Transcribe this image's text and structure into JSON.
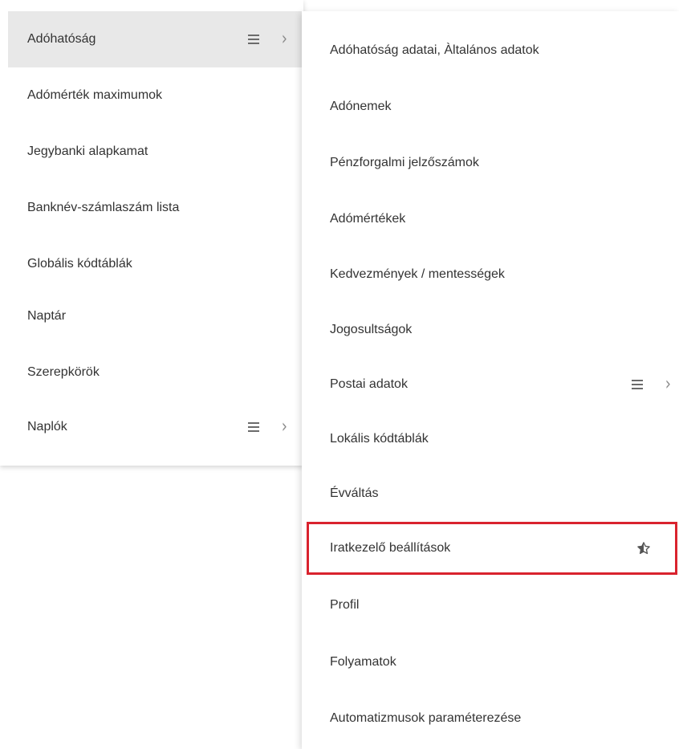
{
  "left_menu": {
    "items": [
      {
        "label": "Adóhatóság",
        "has_submenu": true,
        "active": true
      },
      {
        "label": "Adómérték maximumok"
      },
      {
        "label": "Jegybanki alapkamat"
      },
      {
        "label": "Banknév-számlaszám lista"
      },
      {
        "label": "Globális kódtáblák"
      },
      {
        "label": "Naptár"
      },
      {
        "label": "Szerepkörök"
      },
      {
        "label": "Naplók",
        "has_submenu": true
      }
    ]
  },
  "sub_menu": {
    "items": [
      {
        "label": "Adóhatóság adatai, Àltalános adatok"
      },
      {
        "label": "Adónemek"
      },
      {
        "label": "Pénzforgalmi jelzőszámok"
      },
      {
        "label": "Adómértékek"
      },
      {
        "label": "Kedvezmények / mentességek"
      },
      {
        "label": "Jogosultságok"
      },
      {
        "label": "Postai adatok",
        "has_submenu": true
      },
      {
        "label": "Lokális kódtáblák"
      },
      {
        "label": "Évváltás"
      },
      {
        "label": "Iratkezelő beállítások",
        "highlighted": true,
        "icon": "star-half-icon"
      },
      {
        "label": "Profil"
      },
      {
        "label": "Folyamatok"
      },
      {
        "label": "Automatizmusok paraméterezése"
      }
    ]
  },
  "colors": {
    "active_bg": "#e8e8e8",
    "highlight_border": "#d9232e",
    "text": "#333333",
    "icon": "#6b6b6b"
  },
  "icons": {
    "submenu_indicator": "hamburger-icon",
    "submenu_arrow": "chevron-right-icon"
  }
}
